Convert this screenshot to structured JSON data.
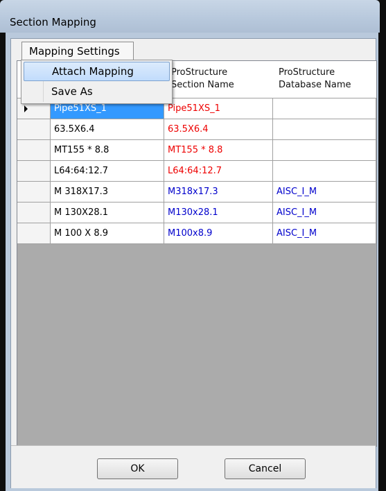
{
  "window": {
    "title": "Section Mapping"
  },
  "menubar": {
    "mapping_settings_label": "Mapping Settings"
  },
  "menu": {
    "items": [
      {
        "label": "Attach Mapping",
        "highlighted": true
      },
      {
        "label": "Save As",
        "highlighted": false
      }
    ]
  },
  "grid": {
    "headers": {
      "source": "",
      "prostructure_section_line1": "ProStructure",
      "prostructure_section_line2": "Section Name",
      "prostructure_db_line1": "ProStructure",
      "prostructure_db_line2": "Database Name"
    },
    "rows": [
      {
        "source": "Pipe51XS_1",
        "section": "Pipe51XS_1",
        "database": "",
        "current": true
      },
      {
        "source": "63.5X6.4",
        "section": "63.5X6.4",
        "database": ""
      },
      {
        "source": "MT155 * 8.8",
        "section": "MT155 * 8.8",
        "database": ""
      },
      {
        "source": "L64:64:12.7",
        "section": "L64:64:12.7",
        "database": ""
      },
      {
        "source": "M  318X17.3",
        "section": "M318x17.3",
        "database": "AISC_I_M"
      },
      {
        "source": "M 130X28.1",
        "section": "M130x28.1",
        "database": "AISC_I_M"
      },
      {
        "source": "M 100 X  8.9",
        "section": "M100x8.9",
        "database": "AISC_I_M"
      }
    ]
  },
  "buttons": {
    "ok": "OK",
    "cancel": "Cancel"
  },
  "colors": {
    "unmapped_text": "#ee0000",
    "mapped_text": "#0000cc",
    "selection": "#3399ff"
  }
}
